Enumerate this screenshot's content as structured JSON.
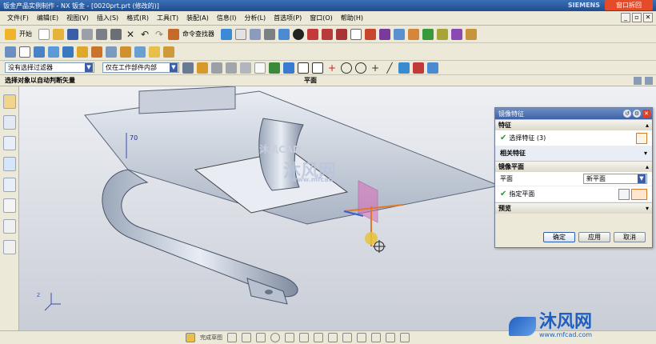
{
  "window": {
    "title": "钣金产品实例制作 - NX 钣金 - [0020prt.prt (修改的)]",
    "brand": "SIEMENS",
    "notice_button": "窗口拆回"
  },
  "menu": [
    "文件(F)",
    "编辑(E)",
    "视图(V)",
    "插入(S)",
    "格式(R)",
    "工具(T)",
    "装配(A)",
    "信息(I)",
    "分析(L)",
    "首选项(P)",
    "窗口(O)",
    "帮助(H)"
  ],
  "toolbar": {
    "start_label": "开始",
    "cmd_finder_label": "命令查找器"
  },
  "selection": {
    "filter_value": "没有选择过滤器",
    "scope_value": "仅在工作部件内部"
  },
  "cue": {
    "prompt": "选择对象以自动判断矢量",
    "status": "平面"
  },
  "viewport": {
    "dim_label": "70",
    "watermark_top": "沐风CAD",
    "watermark_center": "沐风网",
    "watermark_url": "www.mfcad.com",
    "logo_text": "沐风网",
    "logo_url": "www.mfcad.com"
  },
  "dialog": {
    "title": "镜像特征",
    "section_feature": "特征",
    "select_feature_label": "选择特征 (3)",
    "related_feature_label": "相关特征",
    "section_mirror_plane": "镜像平面",
    "plane_label": "平面",
    "plane_value": "新平面",
    "specify_plane_label": "指定平面",
    "section_preview": "预览",
    "ok_label": "确定",
    "apply_label": "应用",
    "cancel_label": "取消"
  },
  "bottom": {
    "sketch_label": "完成草图"
  },
  "colors": {
    "titlebar": "#1f4c8f",
    "dialog_title": "#3e62a6",
    "plane_preview": "#d86ab8",
    "watermark": "#1f5fbf"
  }
}
